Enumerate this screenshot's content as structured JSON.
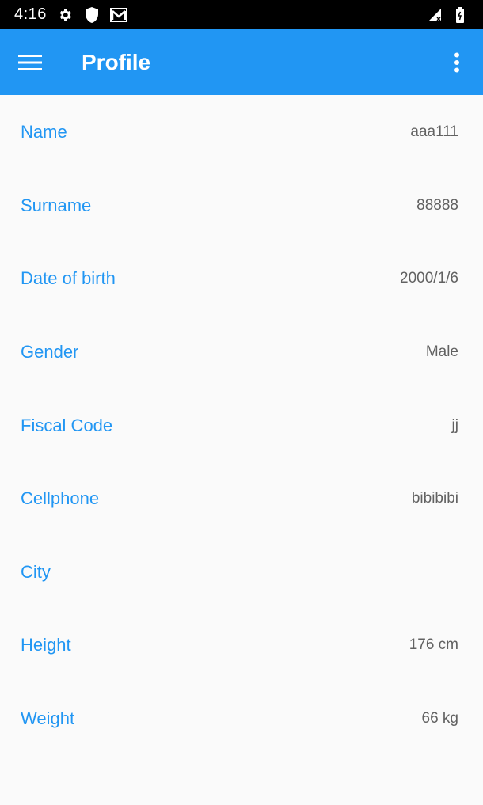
{
  "status": {
    "time": "4:16",
    "icons": [
      "gear-icon",
      "shield-icon",
      "gmail-icon",
      "signal-icon",
      "battery-icon"
    ]
  },
  "app_bar": {
    "title": "Profile",
    "menu_icon": "hamburger-menu-icon",
    "overflow_icon": "more-vert-icon",
    "color": "#2196f3"
  },
  "profile": {
    "fields": [
      {
        "label": "Name",
        "value": "aaa111"
      },
      {
        "label": "Surname",
        "value": "88888"
      },
      {
        "label": "Date of birth",
        "value": "2000/1/6"
      },
      {
        "label": "Gender",
        "value": "Male"
      },
      {
        "label": "Fiscal Code",
        "value": "jj"
      },
      {
        "label": "Cellphone",
        "value": "bibibibi"
      },
      {
        "label": "City",
        "value": ""
      },
      {
        "label": "Height",
        "value": "176 cm"
      },
      {
        "label": "Weight",
        "value": "66 kg"
      }
    ]
  },
  "colors": {
    "accent": "#2196f3",
    "value_text": "#616161",
    "background": "#fafafa"
  }
}
